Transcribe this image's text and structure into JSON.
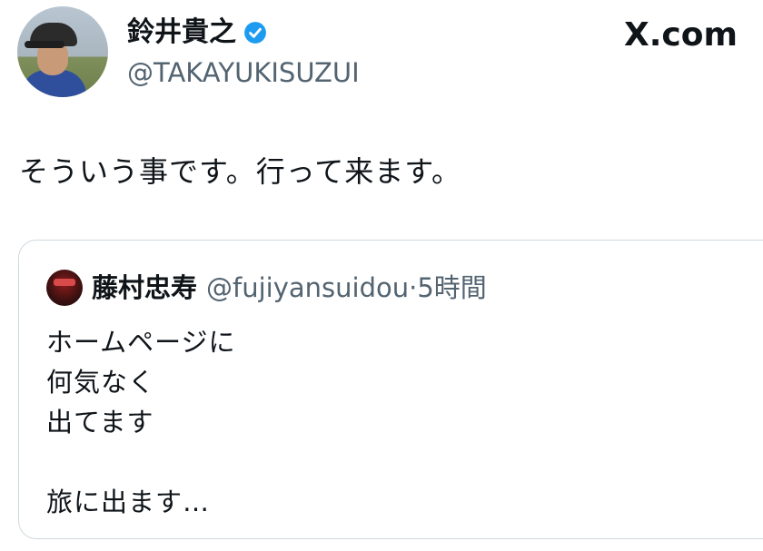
{
  "author": {
    "display_name": "鈴井貴之",
    "handle": "@TAKAYUKISUZUI",
    "verified": true
  },
  "brand": {
    "label": "X.com"
  },
  "tweet": {
    "text": "そういう事です。行って来ます。"
  },
  "quoted_tweet": {
    "display_name": "藤村忠寿",
    "handle": "@fujiyansuidou",
    "separator": "·",
    "time": "5時間",
    "lines": [
      "ホームページに",
      "何気なく",
      "出てます",
      "",
      "旅に出ます…"
    ]
  },
  "colors": {
    "text": "#0f1419",
    "secondary_text": "#536471",
    "verified_badge": "#1d9bf0",
    "card_border": "#cfd9de"
  },
  "icons": {
    "verified": "verified-badge-icon"
  }
}
